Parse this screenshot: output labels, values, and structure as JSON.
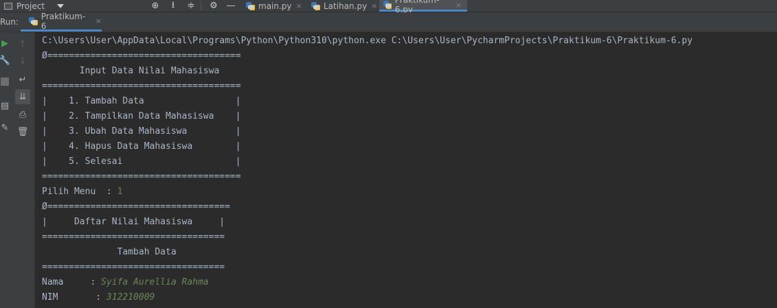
{
  "topbar": {
    "project_label": "Project",
    "tabs": [
      {
        "label": "main.py",
        "close": "×",
        "active": false
      },
      {
        "label": "Latihan.py",
        "close": "×",
        "active": false
      },
      {
        "label": "Praktikum-6.py",
        "close": "×",
        "active": true
      }
    ],
    "icons": [
      "crosshair-icon",
      "collapse-all-icon",
      "expand-all-icon",
      "gear-icon",
      "minimize-icon"
    ]
  },
  "runbar": {
    "label": "Run:",
    "tab_label": "Praktikum-6",
    "close": "×"
  },
  "gutter_icons": [
    "run-icon",
    "wrench-icon",
    "stop-icon",
    "layout-icon",
    "pin-icon",
    "up-arrow-icon",
    "down-arrow-icon",
    "soft-wrap-icon",
    "scroll-to-end-icon",
    "print-icon",
    "trash-icon"
  ],
  "colors": {
    "background": "#2b2b2b",
    "panel": "#3c3f41",
    "output_text": "#a9b7c6",
    "user_input": "#6a8759",
    "accent": "#4a88c7"
  },
  "console": {
    "lines": [
      {
        "text": "C:\\Users\\User\\AppData\\Local\\Programs\\Python\\Python310\\python.exe C:\\Users\\User\\PycharmProjects\\Praktikum-6\\Praktikum-6.py"
      },
      {
        "text": "Ø===================================="
      },
      {
        "text": "       Input Data Nilai Mahasiswa"
      },
      {
        "text": "====================================="
      },
      {
        "text": "|    1. Tambah Data                 |"
      },
      {
        "text": "|    2. Tampilkan Data Mahasiswa    |"
      },
      {
        "text": "|    3. Ubah Data Mahasiswa         |"
      },
      {
        "text": "|    4. Hapus Data Mahasiswa        |"
      },
      {
        "text": "|    5. Selesai                     |"
      },
      {
        "text": "====================================="
      },
      {
        "text": "Pilih Menu  : ",
        "input": "1"
      },
      {
        "text": "Ø=================================="
      },
      {
        "text": "|     Daftar Nilai Mahasiswa     |"
      },
      {
        "text": "=================================="
      },
      {
        "text": "              Tambah Data"
      },
      {
        "text": "=================================="
      },
      {
        "text": "Nama     : ",
        "input": "Syifa Aurellia Rahma"
      },
      {
        "text": "NIM       : ",
        "input": "312210009"
      }
    ]
  }
}
